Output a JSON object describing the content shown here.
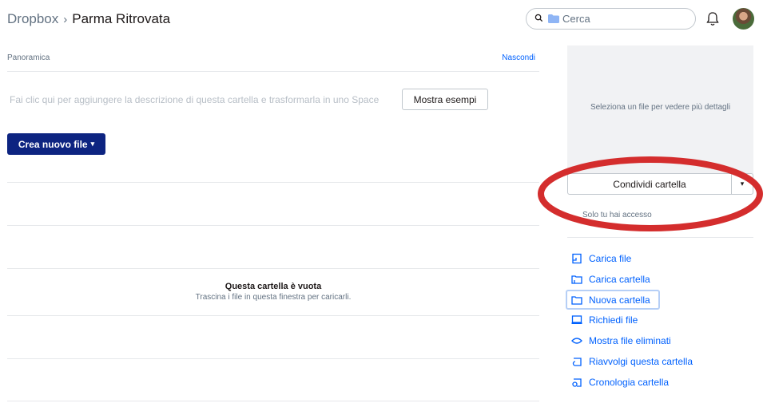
{
  "header": {
    "breadcrumb_root": "Dropbox",
    "breadcrumb_separator": "›",
    "breadcrumb_current": "Parma Ritrovata",
    "search_placeholder": "Cerca",
    "search_icon": "search-icon",
    "folder_icon": "folder-icon",
    "bell_icon": "bell-icon"
  },
  "overview": {
    "label": "Panoramica",
    "hide_link": "Nascondi",
    "description_placeholder": "Fai clic qui per aggiungere la descrizione di questa cartella e trasformarla in uno Space",
    "examples_button": "Mostra esempi",
    "create_button": "Crea nuovo file",
    "create_caret": "▾"
  },
  "empty_state": {
    "title": "Questa cartella è vuota",
    "subtitle": "Trascina i file in questa finestra per caricarli."
  },
  "details": {
    "placeholder": "Seleziona un file per vedere più dettagli",
    "share_button": "Condividi cartella",
    "share_caret": "▾",
    "access_text": "Solo tu hai accesso"
  },
  "actions": [
    {
      "label": "Carica file",
      "icon": "upload-file-icon"
    },
    {
      "label": "Carica cartella",
      "icon": "upload-folder-icon"
    },
    {
      "label": "Nuova cartella",
      "icon": "new-folder-icon"
    },
    {
      "label": "Richiedi file",
      "icon": "request-files-icon"
    },
    {
      "label": "Mostra file eliminati",
      "icon": "eye-icon"
    },
    {
      "label": "Riavvolgi questa cartella",
      "icon": "rewind-icon"
    },
    {
      "label": "Cronologia cartella",
      "icon": "history-icon"
    }
  ],
  "colors": {
    "accent": "#0061fe",
    "primary_button": "#0d2481",
    "annotation": "#d42d2d",
    "panel_bg": "#f1f2f4"
  }
}
